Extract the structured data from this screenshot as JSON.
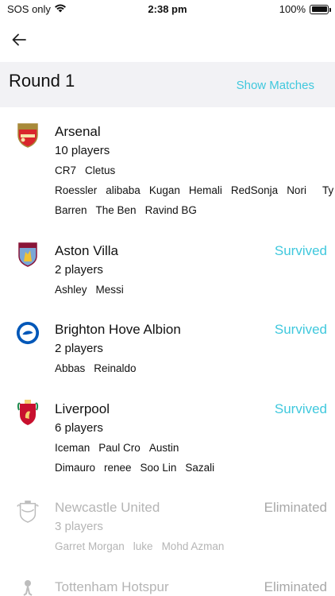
{
  "status_bar": {
    "carrier": "SOS only",
    "time": "2:38 pm",
    "battery": "100%"
  },
  "header": {
    "title": "Round 1",
    "show_matches_label": "Show Matches"
  },
  "colors": {
    "accent": "#3fc8dd",
    "muted": "#b5b5b5",
    "header_bg": "#f2f2f5"
  },
  "teams": [
    {
      "name": "Arsenal",
      "crest_icon": "arsenal-crest-icon",
      "status": "",
      "player_count": "10 players",
      "player_rows": [
        [
          "CR7",
          "Cletus"
        ],
        [
          "Roessler",
          "alibaba",
          "Kugan",
          "Hemali",
          "RedSonja",
          "Nori",
          "Ty"
        ],
        [
          "Barren",
          "The Ben",
          "Ravind BG"
        ]
      ]
    },
    {
      "name": "Aston Villa",
      "crest_icon": "aston-villa-crest-icon",
      "status": "Survived",
      "player_count": "2 players",
      "player_rows": [
        [
          "Ashley",
          "Messi"
        ]
      ]
    },
    {
      "name": "Brighton Hove Albion",
      "crest_icon": "brighton-crest-icon",
      "status": "Survived",
      "player_count": "2 players",
      "player_rows": [
        [
          "Abbas",
          "Reinaldo"
        ]
      ]
    },
    {
      "name": "Liverpool",
      "crest_icon": "liverpool-crest-icon",
      "status": "Survived",
      "player_count": "6 players",
      "player_rows": [
        [
          "Iceman",
          "Paul Cro",
          "Austin"
        ],
        [
          "Dimauro",
          "renee",
          "Soo Lin",
          "Sazali"
        ]
      ]
    },
    {
      "name": "Newcastle United",
      "crest_icon": "newcastle-crest-icon",
      "status": "Eliminated",
      "player_count": "3 players",
      "player_rows": [
        [
          "Garret Morgan",
          "luke",
          "Mohd Azman"
        ]
      ]
    },
    {
      "name": "Tottenham Hotspur",
      "crest_icon": "tottenham-crest-icon",
      "status": "Eliminated",
      "player_count": "",
      "player_rows": []
    }
  ]
}
